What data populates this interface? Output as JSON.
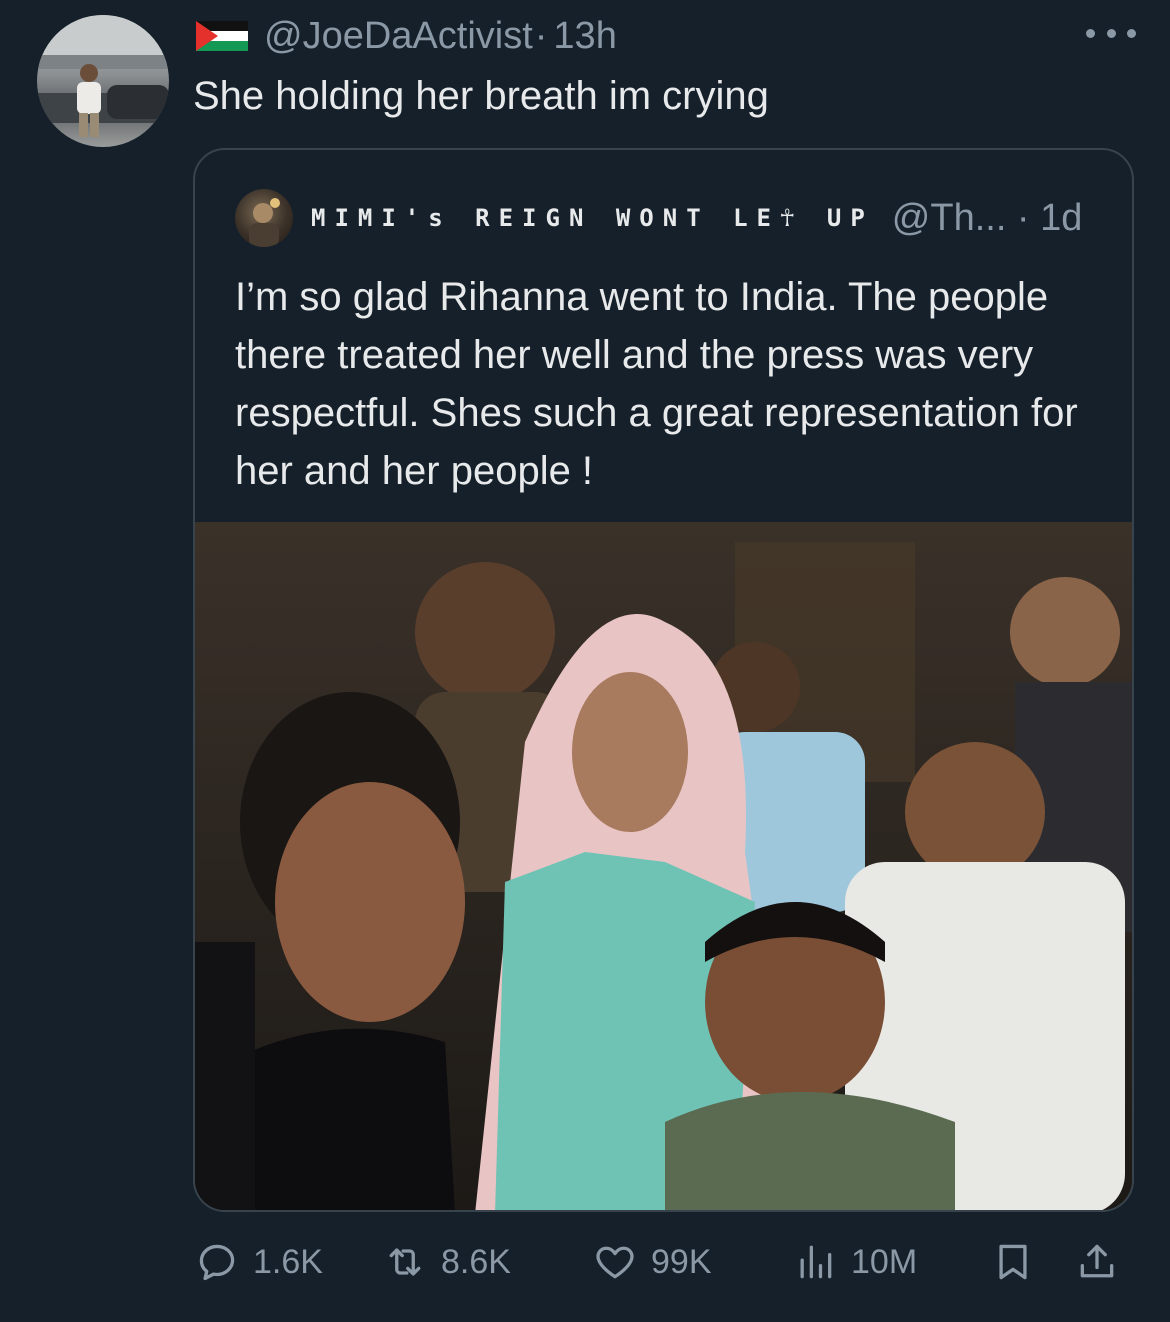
{
  "tweet": {
    "handle": "@JoeDaActivist",
    "separator": "·",
    "time": "13h",
    "text": "She holding her breath im crying"
  },
  "quote": {
    "display_name": "MIMI's REIGN WONT LE☥ UP",
    "handle_time": "@Th... · 1d",
    "text": "I’m so glad Rihanna went to India. The people there treated her well and the press was very respectful. Shes such a great representation for her and her people !"
  },
  "actions": {
    "replies": "1.6K",
    "reposts": "8.6K",
    "likes": "99K",
    "views": "10M"
  },
  "icons": {
    "flag": "palestine-flag-icon",
    "more": "more-dots-icon",
    "reply": "reply-icon",
    "repost": "repost-icon",
    "like": "heart-icon",
    "views": "views-chart-icon",
    "bookmark": "bookmark-icon",
    "share": "share-icon"
  },
  "colors": {
    "background": "#15202b",
    "text_primary": "#e7e9ea",
    "text_secondary": "#8b98a5",
    "border": "#38444d"
  }
}
